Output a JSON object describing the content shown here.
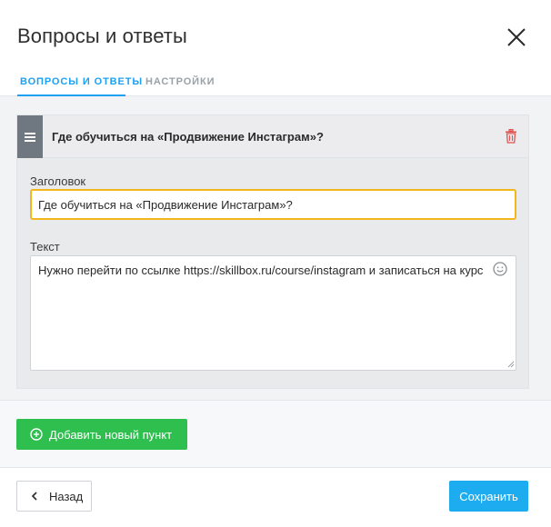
{
  "dialog": {
    "title": "Вопросы и ответы"
  },
  "tabs": [
    {
      "label": "ВОПРОСЫ И ОТВЕТЫ",
      "active": true
    },
    {
      "label": "НАСТРОЙКИ",
      "active": false
    }
  ],
  "item": {
    "title": "Где обучиться на «Продвижение Инстаграм»?",
    "title_field_label": "Заголовок",
    "title_field_value": "Где обучиться на «Продвижение Инстаграм»?",
    "text_field_label": "Текст",
    "text_field_value": "Нужно перейти по ссылке https://skillbox.ru/course/instagram и записаться на курс"
  },
  "actions": {
    "add_label": "Добавить новый пункт",
    "back_label": "Назад",
    "save_label": "Сохранить"
  },
  "colors": {
    "accent": "#1da1f2",
    "add_button": "#2fbf4f",
    "save_button": "#1dacf0",
    "focus_border": "#f3b71d",
    "delete_icon": "#e05252",
    "drag_handle": "#6f7780"
  },
  "icons": {
    "close": "close-icon",
    "drag": "drag-handle-icon",
    "delete": "trash-icon",
    "emoji": "emoji-icon",
    "add": "plus-circle-icon",
    "back": "chevron-left-icon"
  }
}
